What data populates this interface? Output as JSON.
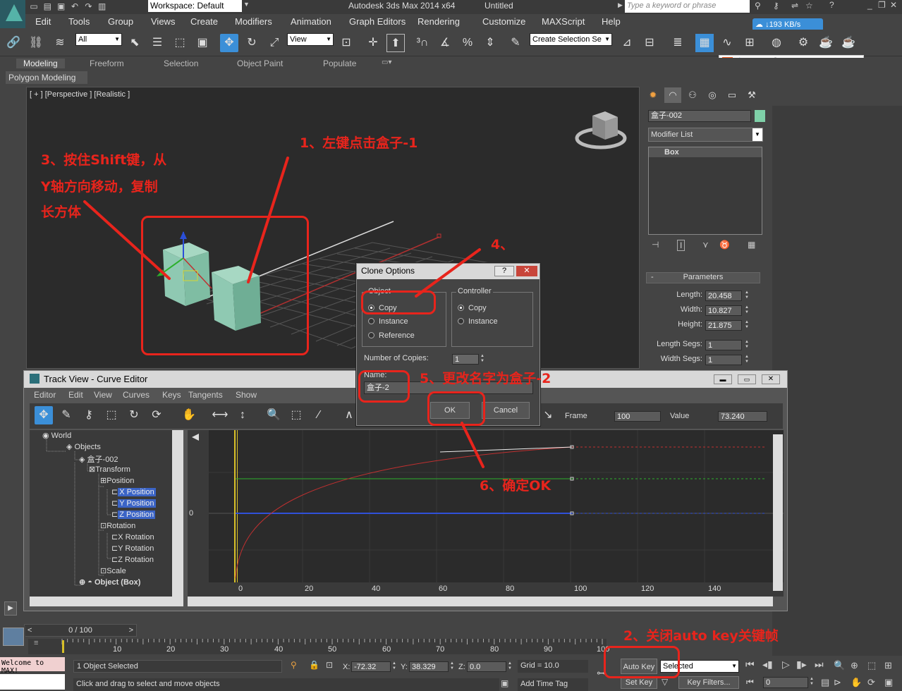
{
  "app": {
    "workspace": "Workspace: Default",
    "title": "Autodesk 3ds Max  2014 x64",
    "document": "Untitled",
    "search_placeholder": "Type a keyword or phrase",
    "net_speed": "↓193 KB/s"
  },
  "menu": [
    "Edit",
    "Tools",
    "Group",
    "Views",
    "Create",
    "Modifiers",
    "Animation",
    "Graph Editors",
    "Rendering",
    "Customize",
    "MAXScript",
    "Help"
  ],
  "toolbar": {
    "filter_value": "All",
    "refcoord_value": "View",
    "selection_set_value": "Create Selection Se"
  },
  "ribbon": {
    "tabs": [
      "Modeling",
      "Freeform",
      "Selection",
      "Object Paint",
      "Populate"
    ],
    "active_tab": "Modeling",
    "sub_label": "Polygon Modeling"
  },
  "viewport": {
    "label": "[ + ] [Perspective ] [Realistic ]"
  },
  "annotations": {
    "a1": "1、左键点击盒子-1",
    "a2": "2、关闭auto key关键帧",
    "a3_line1": "3、按住Shift键，从",
    "a3_line2": "Y轴方向移动，复制",
    "a3_line3": "长方体",
    "a4": "4、",
    "a5": "5、更改名字为盒子-2",
    "a6": "6、确定OK"
  },
  "command_panel": {
    "object_name": "盒子-002",
    "modifier_list": "Modifier List",
    "stack_item": "Box",
    "parameters_title": "Parameters",
    "params": [
      {
        "label": "Length:",
        "value": "20.458"
      },
      {
        "label": "Width:",
        "value": "10.827"
      },
      {
        "label": "Height:",
        "value": "21.875"
      },
      {
        "label": "Length Segs:",
        "value": "1"
      },
      {
        "label": "Width Segs:",
        "value": "1"
      }
    ]
  },
  "clone_dialog": {
    "title": "Clone Options",
    "help": "?",
    "object_group": "Object",
    "object_options": [
      "Copy",
      "Instance",
      "Reference"
    ],
    "controller_group": "Controller",
    "controller_options": [
      "Copy",
      "Instance"
    ],
    "copies_label": "Number of Copies:",
    "copies_value": "1",
    "name_label": "Name:",
    "name_value": "盒子-2",
    "ok": "OK",
    "cancel": "Cancel"
  },
  "track_view": {
    "title": "Track View - Curve Editor",
    "menu": [
      "Editor",
      "Edit",
      "View",
      "Curves",
      "Keys",
      "Tangents",
      "Show"
    ],
    "frame_label": "Frame",
    "frame_value": "100",
    "value_label": "Value",
    "value_value": "73.240",
    "tree": [
      {
        "label": "World"
      },
      {
        "label": "Objects"
      },
      {
        "label": "盒子-002"
      },
      {
        "label": "Transform"
      },
      {
        "label": "Position"
      },
      {
        "label": "X Position"
      },
      {
        "label": "Y Position"
      },
      {
        "label": "Z Position"
      },
      {
        "label": "Rotation"
      },
      {
        "label": "X Rotation"
      },
      {
        "label": "Y Rotation"
      },
      {
        "label": "Z Rotation"
      },
      {
        "label": "Scale"
      },
      {
        "label": "Object (Box)"
      }
    ],
    "zero_label": "0",
    "ruler": [
      "0",
      "20",
      "40",
      "60",
      "80",
      "100",
      "120",
      "140"
    ]
  },
  "timeline": {
    "frame_counter": "0 / 100",
    "ticks": [
      "10",
      "20",
      "30",
      "40",
      "50",
      "60",
      "70",
      "80",
      "90",
      "100"
    ]
  },
  "status": {
    "welcome": "Welcome to MAX!",
    "selected": "1 Object Selected",
    "hint": "Click and drag to select and move objects",
    "x_label": "X:",
    "x_value": "-72.32",
    "y_label": "Y:",
    "y_value": "38.329",
    "z_label": "Z:",
    "z_value": "0.0",
    "grid": "Grid = 10.0",
    "add_time_tag": "Add Time Tag",
    "auto_key": "Auto Key",
    "set_key": "Set Key",
    "key_mode": "Selected",
    "key_filters": "Key Filters...",
    "current_frame": "0"
  }
}
